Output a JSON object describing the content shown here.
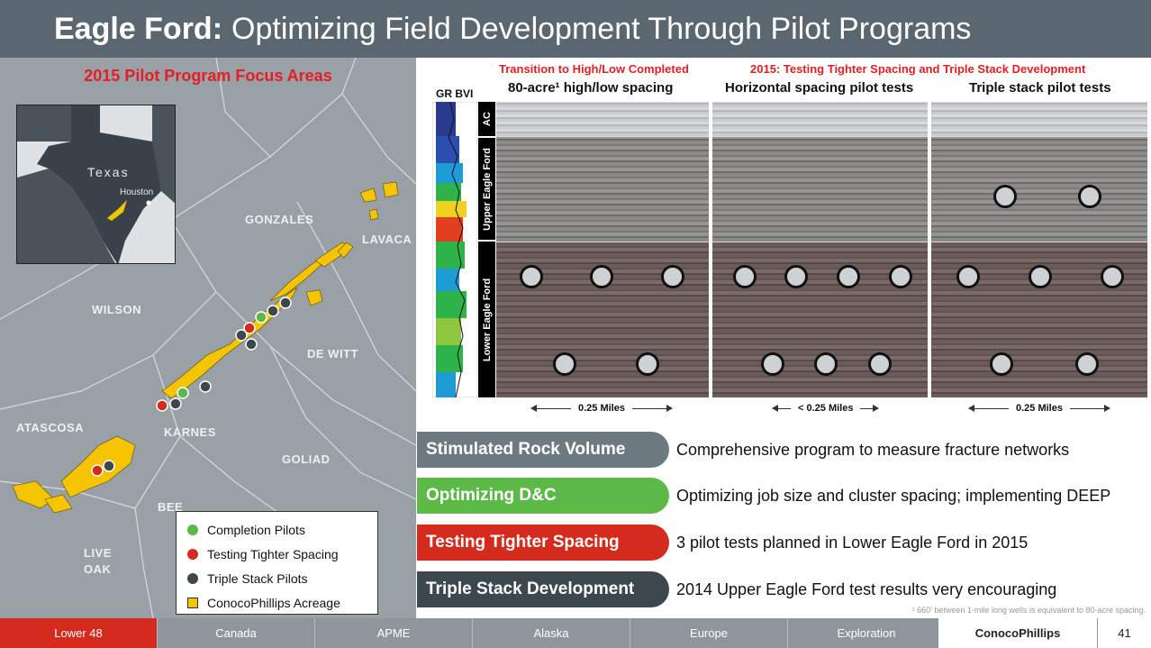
{
  "header": {
    "title_bold": "Eagle Ford:",
    "title_rest": "Optimizing Field Development Through Pilot Programs"
  },
  "map": {
    "title": "2015 Pilot Program Focus Areas",
    "inset": {
      "state": "Texas",
      "city": "Houston"
    },
    "counties": [
      "GONZALES",
      "LAVACA",
      "WILSON",
      "DE WITT",
      "ATASCOSA",
      "KARNES",
      "GOLIAD",
      "BEE",
      "LIVE OAK"
    ],
    "legend": [
      {
        "label": "Completion Pilots",
        "color": "#5cb847"
      },
      {
        "label": "Testing Tighter Spacing",
        "color": "#d52b1e"
      },
      {
        "label": "Triple Stack Pilots",
        "color": "#3d474e"
      },
      {
        "label": "ConocoPhillips Acreage",
        "color": "#f5c400"
      }
    ]
  },
  "cross_section": {
    "header_left_red": "Transition to High/Low Completed",
    "header_right_red": "2015: Testing Tighter Spacing and Triple Stack Development",
    "panel1_title": "80-acre¹ high/low spacing",
    "panel2_title": "Horizontal spacing pilot tests",
    "panel3_title": "Triple stack pilot tests",
    "log_label": "GR BVI",
    "zones": {
      "ac": "AC",
      "upper": "Upper Eagle Ford",
      "lower": "Lower Eagle Ford"
    },
    "scale1": "0.25 Miles",
    "scale2": "< 0.25 Miles",
    "scale3": "0.25 Miles"
  },
  "programs": [
    {
      "name": "Stimulated Rock Volume",
      "desc": "Comprehensive program to measure fracture networks",
      "color": "#6d7a82"
    },
    {
      "name": "Optimizing D&C",
      "desc": "Optimizing job size and cluster spacing; implementing DEEP",
      "color": "#5cb847"
    },
    {
      "name": "Testing Tighter Spacing",
      "desc": "3 pilot tests planned in Lower Eagle Ford in 2015",
      "color": "#d52b1e"
    },
    {
      "name": "Triple Stack Development",
      "desc": "2014 Upper Eagle Ford test results very encouraging",
      "color": "#3d474e"
    }
  ],
  "footnote": "¹ 660' between 1-mile long wells is equivalent to 80-acre spacing.",
  "footer": {
    "nav": [
      "Lower 48",
      "Canada",
      "APME",
      "Alaska",
      "Europe",
      "Exploration"
    ],
    "active": "Lower 48",
    "logo": "ConocoPhillips",
    "page": "41"
  }
}
